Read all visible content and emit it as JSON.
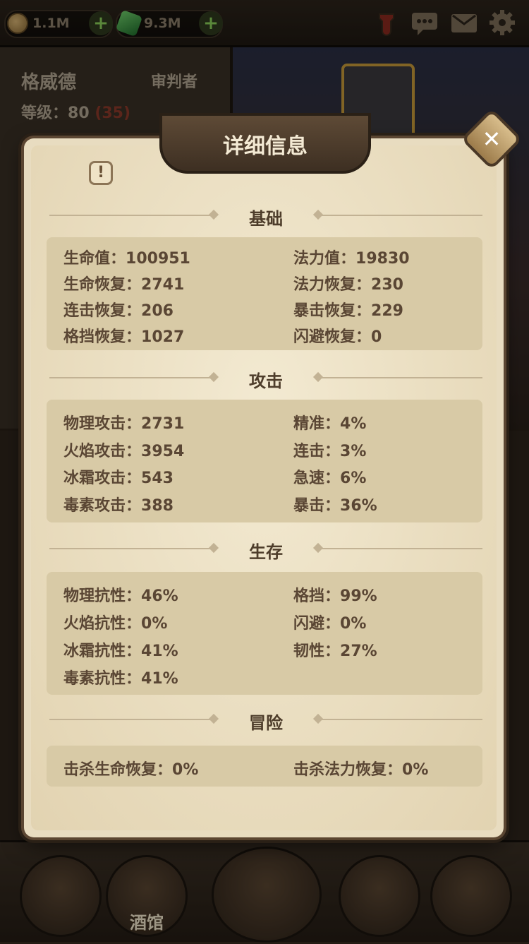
{
  "topbar": {
    "gold_value": "1.1M",
    "gem_value": "9.3M",
    "plus_glyph": "+"
  },
  "hero": {
    "name": "格威德",
    "class": "审判者",
    "level_label": "等级：",
    "level_value": "80",
    "level_bonus": "(35)"
  },
  "dialog": {
    "title": "详细信息",
    "info_glyph": "!",
    "close_glyph": "✕",
    "sections": {
      "basic": {
        "title": "基础",
        "left": [
          {
            "label": "生命值",
            "value": "100951"
          },
          {
            "label": "生命恢复",
            "value": "2741"
          },
          {
            "label": "连击恢复",
            "value": "206"
          },
          {
            "label": "格挡恢复",
            "value": "1027"
          }
        ],
        "right": [
          {
            "label": "法力值",
            "value": "19830"
          },
          {
            "label": "法力恢复",
            "value": "230"
          },
          {
            "label": "暴击恢复",
            "value": "229"
          },
          {
            "label": "闪避恢复",
            "value": "0"
          }
        ]
      },
      "attack": {
        "title": "攻击",
        "left": [
          {
            "label": "物理攻击",
            "value": "2731"
          },
          {
            "label": "火焰攻击",
            "value": "3954"
          },
          {
            "label": "冰霜攻击",
            "value": "543"
          },
          {
            "label": "毒素攻击",
            "value": "388"
          }
        ],
        "right": [
          {
            "label": "精准",
            "value": "4%"
          },
          {
            "label": "连击",
            "value": "3%"
          },
          {
            "label": "急速",
            "value": "6%"
          },
          {
            "label": "暴击",
            "value": "36%"
          }
        ]
      },
      "survival": {
        "title": "生存",
        "left": [
          {
            "label": "物理抗性",
            "value": "46%"
          },
          {
            "label": "火焰抗性",
            "value": "0%"
          },
          {
            "label": "冰霜抗性",
            "value": "41%"
          },
          {
            "label": "毒素抗性",
            "value": "41%"
          }
        ],
        "right": [
          {
            "label": "格挡",
            "value": "99%"
          },
          {
            "label": "闪避",
            "value": "0%"
          },
          {
            "label": "韧性",
            "value": "27%"
          }
        ]
      },
      "adventure": {
        "title": "冒险",
        "left": [
          {
            "label": "击杀生命恢复",
            "value": "0%"
          }
        ],
        "right": [
          {
            "label": "击杀法力恢复",
            "value": "0%"
          }
        ]
      }
    }
  },
  "bottom_nav": {
    "tavern_label": "酒馆"
  },
  "colors": {
    "parchment": "#e8dcc0",
    "stat_box": "#d8caa6",
    "stat_text": "#5a4634",
    "accent_gold": "#c69a3a"
  }
}
